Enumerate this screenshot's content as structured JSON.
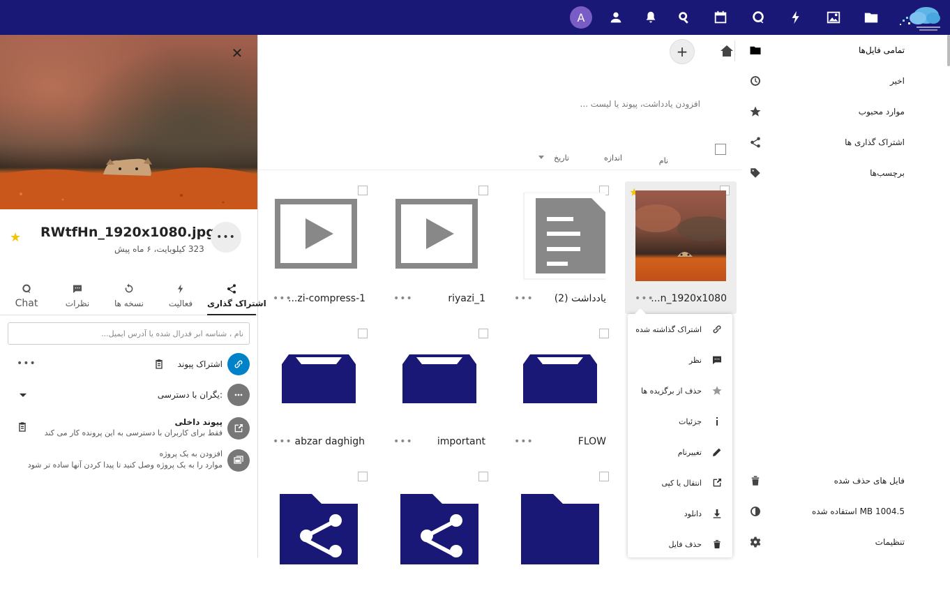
{
  "topbar": {
    "avatar_letter": "A",
    "apps": [
      "contacts-icon",
      "notifications-icon",
      "search-icon",
      "calendar-icon",
      "talk-icon",
      "activity-icon",
      "photos-icon",
      "files-icon"
    ]
  },
  "nav": {
    "items": [
      {
        "label": "تمامی فایل‌ها",
        "icon": "folder-icon",
        "active": true
      },
      {
        "label": "اخیر",
        "icon": "clock-icon"
      },
      {
        "label": "موارد محبوب",
        "icon": "star-icon"
      },
      {
        "label": "اشتراک گذاری ها",
        "icon": "share-icon"
      },
      {
        "label": "برچسب‌ها",
        "icon": "tag-icon"
      }
    ],
    "bottom": [
      {
        "label": "فایل های حذف شده",
        "icon": "trash-icon"
      },
      {
        "label": "1004.5 MB استفاده شده",
        "icon": "quota-icon"
      },
      {
        "label": "تنظیمات",
        "icon": "gear-icon"
      }
    ]
  },
  "main": {
    "notes_placeholder": "افزودن یادداشت، پیوند یا لیست ...",
    "headers": {
      "name": "نام",
      "size": "اندازه",
      "date": "تاریخ"
    },
    "files": [
      {
        "name": "RWtfHn_1920x1080.jpg",
        "display": "...n_1920x1080",
        "type": "image",
        "starred": true,
        "selected": true
      },
      {
        "name": "یادداشت (2)",
        "display": "یادداشت (2)",
        "type": "document"
      },
      {
        "name": "riyazi_1",
        "display": "riyazi_1",
        "type": "video"
      },
      {
        "name": "zi-compress-1",
        "display": "...zi-compress-1",
        "type": "video"
      },
      {
        "name": "FLOW",
        "display": "FLOW",
        "type": "folder-box"
      },
      {
        "name": "important",
        "display": "important",
        "type": "folder-box"
      },
      {
        "name": "abzar daghigh",
        "display": "abzar daghigh",
        "type": "folder-box"
      },
      {
        "name": "",
        "display": "",
        "type": "folder"
      },
      {
        "name": "",
        "display": "",
        "type": "folder-shared"
      },
      {
        "name": "",
        "display": "",
        "type": "folder-shared"
      }
    ],
    "context_menu": [
      {
        "label": "اشتراک گذاشته شده",
        "icon": "link-icon"
      },
      {
        "label": "نظر",
        "icon": "comment-icon"
      },
      {
        "label": "حذف از برگزیده ها",
        "icon": "star-icon"
      },
      {
        "label": "جزئیات",
        "icon": "info-icon"
      },
      {
        "label": "تغییرنام",
        "icon": "pencil-icon"
      },
      {
        "label": "انتقال یا کپی",
        "icon": "move-icon"
      },
      {
        "label": "دانلود",
        "icon": "download-icon"
      },
      {
        "label": "حذف فایل",
        "icon": "trash-icon"
      }
    ]
  },
  "sidebar": {
    "file_name": "RWtfHn_1920x1080.jpg",
    "file_meta": "323 کیلوبایت، ۶ ماه پیش",
    "tabs": [
      {
        "label": "اشتراک گذاری",
        "icon": "share-icon",
        "active": true
      },
      {
        "label": "فعالیت",
        "icon": "activity-icon"
      },
      {
        "label": "نسخه ها",
        "icon": "history-icon"
      },
      {
        "label": "نظرات",
        "icon": "comment-icon"
      },
      {
        "label": "Chat",
        "icon": "talk-icon"
      }
    ],
    "share_placeholder": "نام ، شناسه ابر فدرال شده یا آدرس ایمیل...",
    "share_link_label": "اشتراک پیوند",
    "others_access_label": ":یگران با دسترسی",
    "internal_link_title": "پیوند داخلی",
    "internal_link_desc": "فقط برای کاربران با دسترسی به این پرونده کار می کند",
    "project_title": "افزودن به یک پروژه",
    "project_desc": "موارد را به یک پروژه وصل کنید تا پیدا کردن آنها ساده تر شود"
  },
  "colors": {
    "topbar": "#1a1877",
    "folder": "#1a1877",
    "link_circle": "#0082c9",
    "star": "#f4c400"
  }
}
